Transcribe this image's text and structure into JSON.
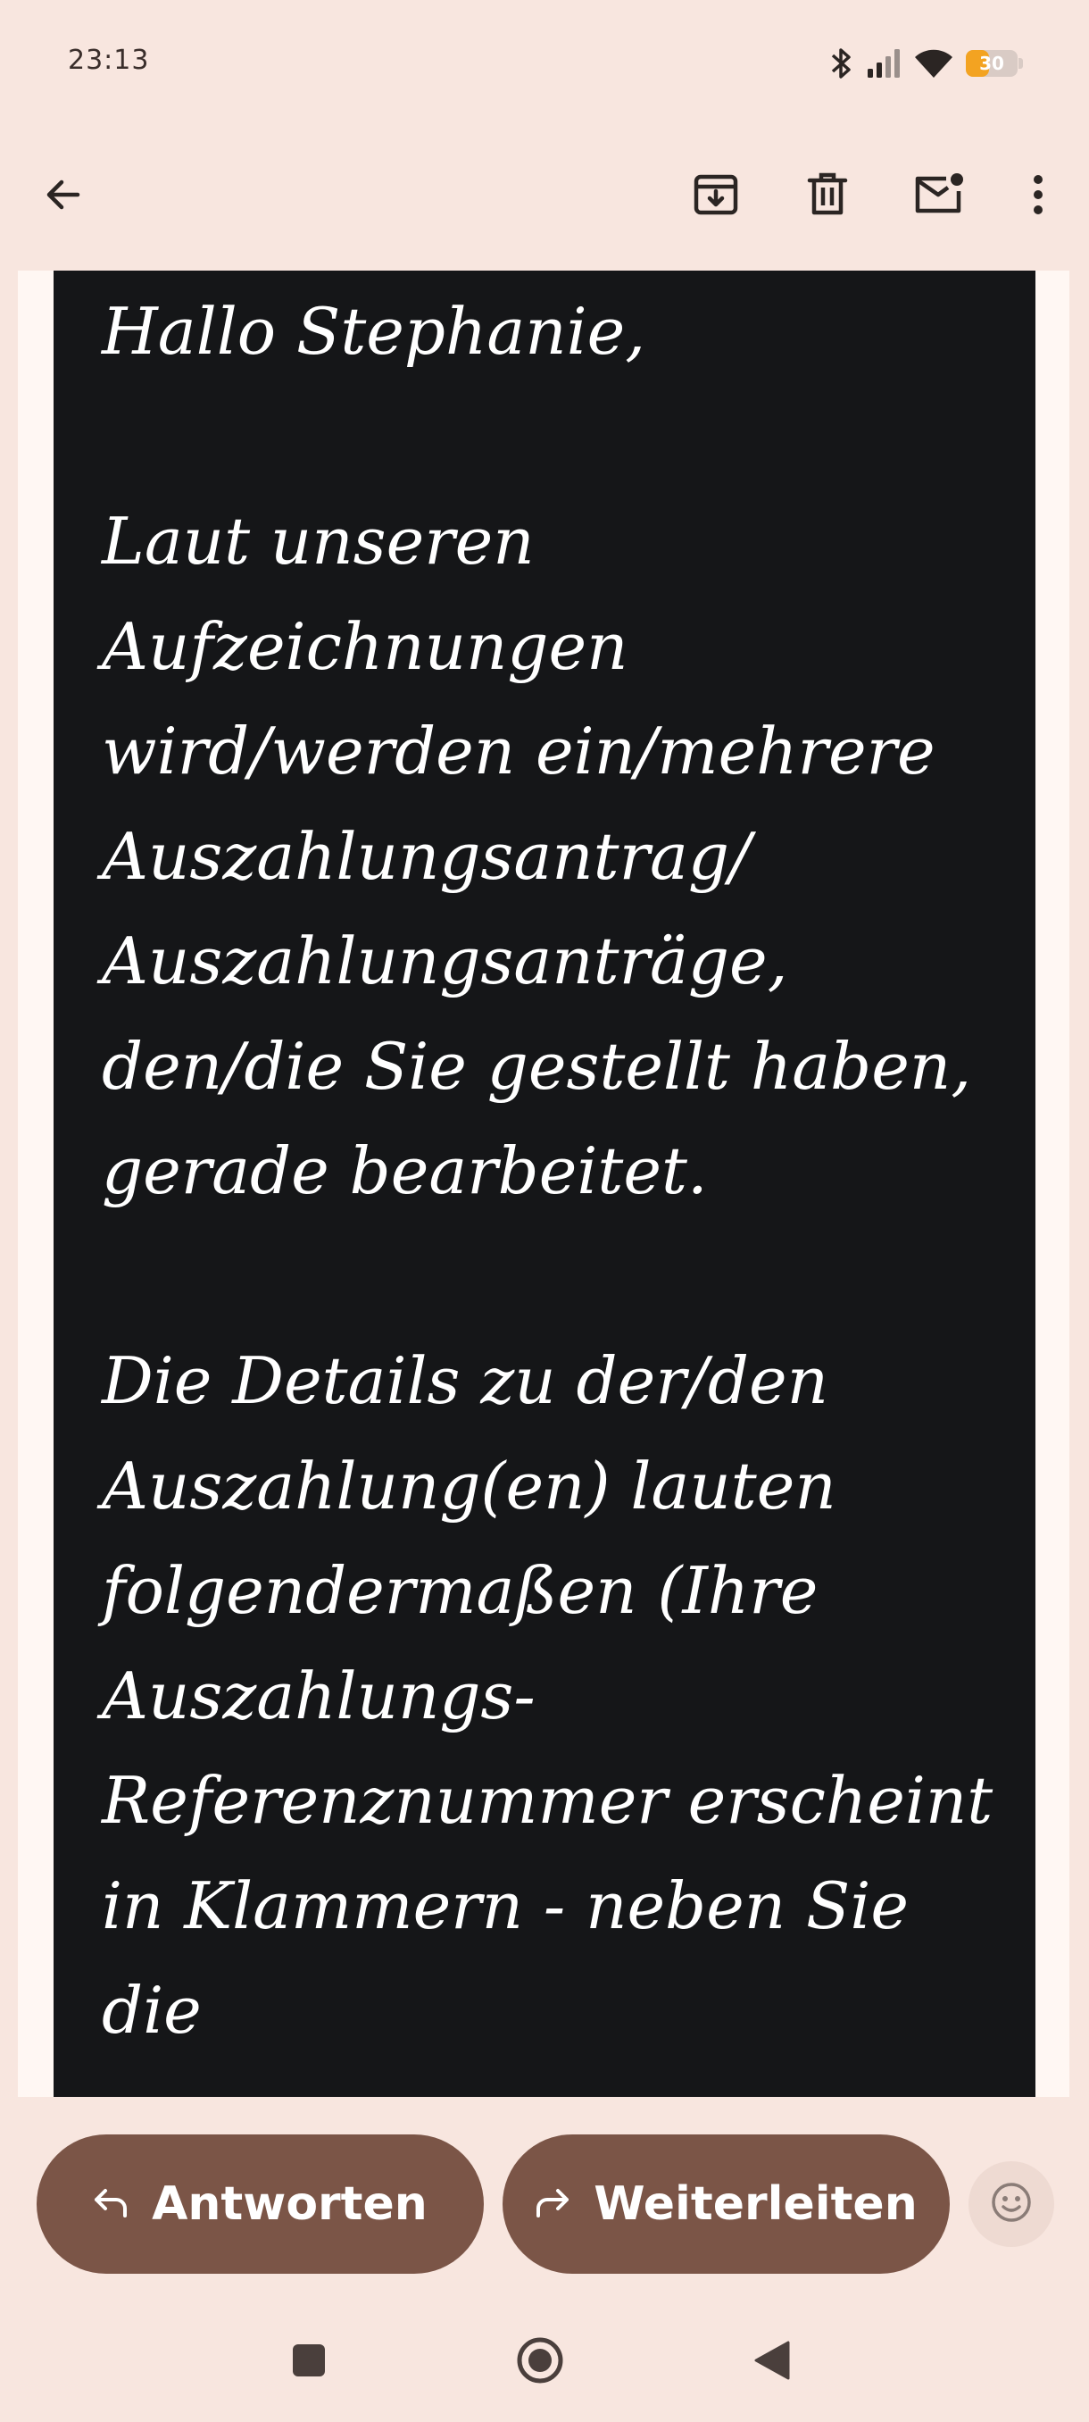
{
  "status_bar": {
    "time": "23:13",
    "battery_level": "30",
    "icons": [
      "bluetooth-icon",
      "signal-icon",
      "wifi-icon",
      "battery-icon"
    ]
  },
  "app_bar": {
    "icons": [
      "back-arrow-icon",
      "archive-icon",
      "delete-icon",
      "mark-unread-icon",
      "more-vert-icon"
    ]
  },
  "email": {
    "paragraphs": [
      "Hallo Stephanie,",
      "Laut unseren Aufzeichnungen wird/werden ein/mehrere Auszahlungsantrag/ Auszahlungsanträge, den/die Sie gestellt haben, gerade bearbeitet.",
      "Die Details zu der/den Auszahlung(en) lauten folgendermaßen (Ihre Auszahlungs- Referenznummer erscheint in Klammern - neben Sie die"
    ]
  },
  "actions": {
    "reply_label": "Antworten",
    "forward_label": "Weiterleiten"
  },
  "colors": {
    "background": "#f8e6df",
    "email_background": "#151618",
    "action_button": "#7b5547",
    "battery": "#f3a321"
  },
  "nav_bar": {
    "icons": [
      "recents-icon",
      "home-icon",
      "back-icon"
    ]
  }
}
